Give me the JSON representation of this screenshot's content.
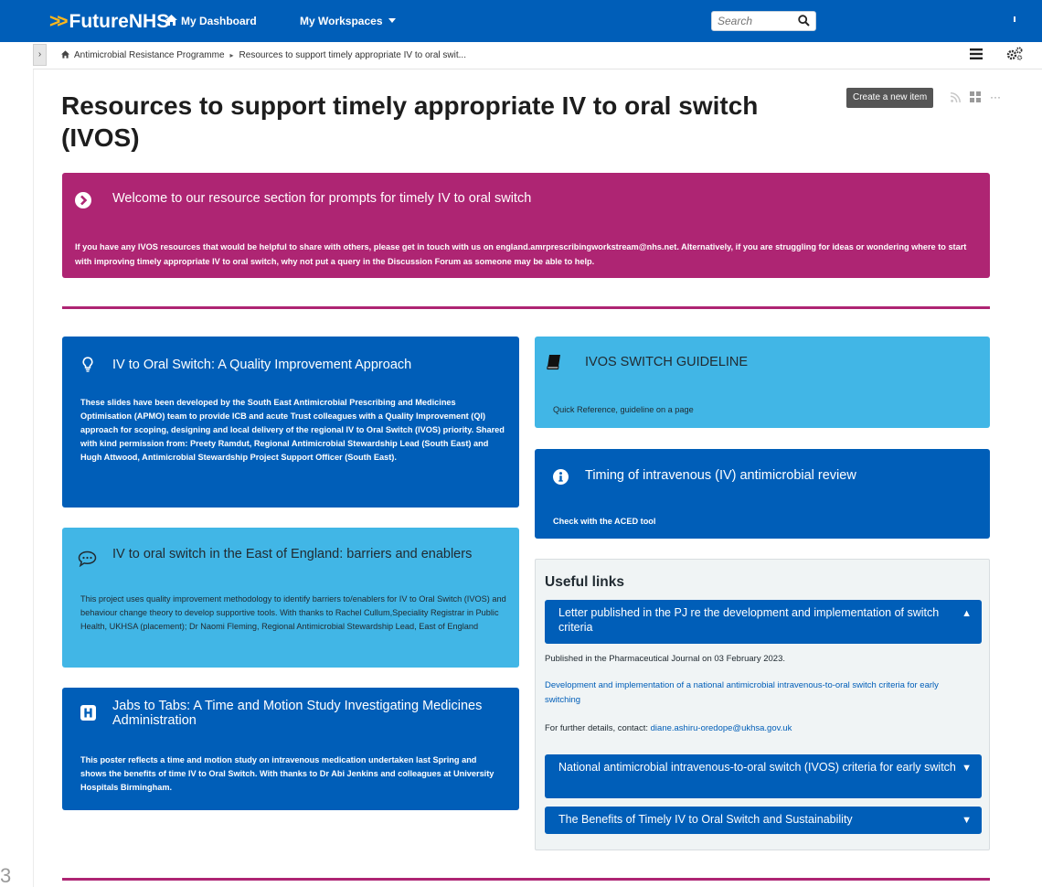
{
  "header": {
    "logo_text": "FutureNHS",
    "nav": [
      {
        "label": "My Dashboard"
      },
      {
        "label": "My Workspaces"
      }
    ],
    "search_placeholder": "Search"
  },
  "breadcrumb": [
    {
      "label": "Antimicrobial Resistance Programme"
    },
    {
      "label": "Resources to support timely appropriate IV to oral swit..."
    }
  ],
  "page": {
    "title": "Resources to support timely appropriate IV to oral switch (IVOS)",
    "create_button": "Create a new item"
  },
  "welcome": {
    "title": "Welcome to our resource section for prompts for timely IV to oral switch",
    "body": "If you have any IVOS resources that would be helpful to share with others, please get in touch with us on england.amrprescribingworkstream@nhs.net. Alternatively, if you are struggling for ideas or wondering where to start with improving timely appropriate IV to oral switch, why not put a query in the Discussion Forum as someone may be able to help."
  },
  "cards": [
    {
      "title": "IV to Oral Switch: A Quality Improvement Approach",
      "body": "These slides have been developed by the South East Antimicrobial Prescribing and Medicines Optimisation (APMO) team to provide ICB and acute Trust colleagues with a Quality Improvement (QI) approach for scoping, designing and local delivery of the regional IV to Oral Switch (IVOS) priority. Shared with kind permission from: Preety Ramdut, Regional Antimicrobial Stewardship Lead (South East) and Hugh Attwood, Antimicrobial Stewardship Project Support Officer (South East).",
      "icon": "lightbulb-icon"
    },
    {
      "title": "IV to oral switch in the East of England: barriers and enablers",
      "body": "This project uses quality improvement methodology to identify barriers to/enablers for IV to Oral Switch (IVOS) and behaviour change theory to develop supportive tools. With thanks to Rachel Cullum,Speciality Registrar in Public Health, UKHSA (placement); Dr Naomi Fleming, Regional Antimicrobial Stewardship Lead, East of England",
      "icon": "speech-bubble-icon"
    },
    {
      "title": "Jabs to Tabs: A Time and Motion Study Investigating Medicines Administration",
      "body": "This poster reflects a time and motion study on intravenous medication undertaken last Spring and shows the benefits of time IV to Oral Switch. With thanks to Dr Abi Jenkins and colleagues at University Hospitals Birmingham.",
      "icon": "hospital-icon"
    },
    {
      "title": "IVOS SWITCH GUIDELINE",
      "body": "Quick Reference, guideline on a page",
      "icon": "book-icon"
    },
    {
      "title": "Timing of intravenous (IV) antimicrobial review",
      "body": "Check with the ACED tool",
      "icon": "info-icon"
    }
  ],
  "useful_links": {
    "heading": "Useful links",
    "accordions": [
      {
        "title": "Letter published in the PJ re the development and implementation of switch criteria",
        "expanded": true,
        "published": "Published in the Pharmaceutical Journal on 03 February 2023.",
        "link_text": "Development and implementation of a national antimicrobial intravenous-to-oral switch criteria for early switching",
        "contact_prefix": "For further details, contact: ",
        "contact_email": "diane.ashiru-oredope@ukhsa.gov.uk"
      },
      {
        "title": "National antimicrobial intravenous-to-oral switch (IVOS) criteria for early switch",
        "expanded": false
      },
      {
        "title": "The Benefits of Timely IV to Oral Switch and Sustainability",
        "expanded": false
      }
    ]
  },
  "edge_digit": "3",
  "colors": {
    "header_blue": "#005eb8",
    "card_dark": "#005eb8",
    "card_light": "#41b6e6",
    "welcome_magenta": "#ae2573",
    "logo_accent": "#ffb81c"
  }
}
